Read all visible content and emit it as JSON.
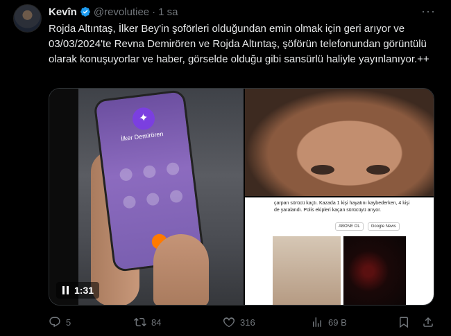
{
  "tweet": {
    "author_name": "Kevîn",
    "handle": "@revolutiee",
    "separator": "·",
    "time": "1 sa",
    "more_label": "···",
    "text": "Rojda Altıntaş, İlker Bey'in şoförleri olduğundan emin olmak için geri arıyor ve 03/03/2024'te Revna Demirören ve Rojda Altıntaş, şöförün telefonundan görüntülü olarak konuşuyorlar ve haber, görselde olduğu gibi sansürlü haliyle yayınlanıyor.++"
  },
  "media": {
    "video_duration": "1:31",
    "phone_caller": "İlker Demirören",
    "news_text": "çarpan sürücü kaçtı. Kazada 1 kişi hayatını kaybederken, 4 kişi de yaralandı. Polis ekipleri kaçan sürücüyü arıyor.",
    "news_subscribe": "ABONE OL",
    "news_google": "Google News"
  },
  "actions": {
    "replies": "5",
    "reposts": "84",
    "likes": "316",
    "views": "69 B"
  },
  "colors": {
    "verified": "#1d9bf0",
    "muted": "#71767b",
    "text": "#e7e9ea"
  },
  "icons": [
    "verified-badge-icon",
    "more-icon",
    "play-pause-icon",
    "reply-icon",
    "repost-icon",
    "like-icon",
    "views-icon",
    "bookmark-icon",
    "share-icon"
  ]
}
